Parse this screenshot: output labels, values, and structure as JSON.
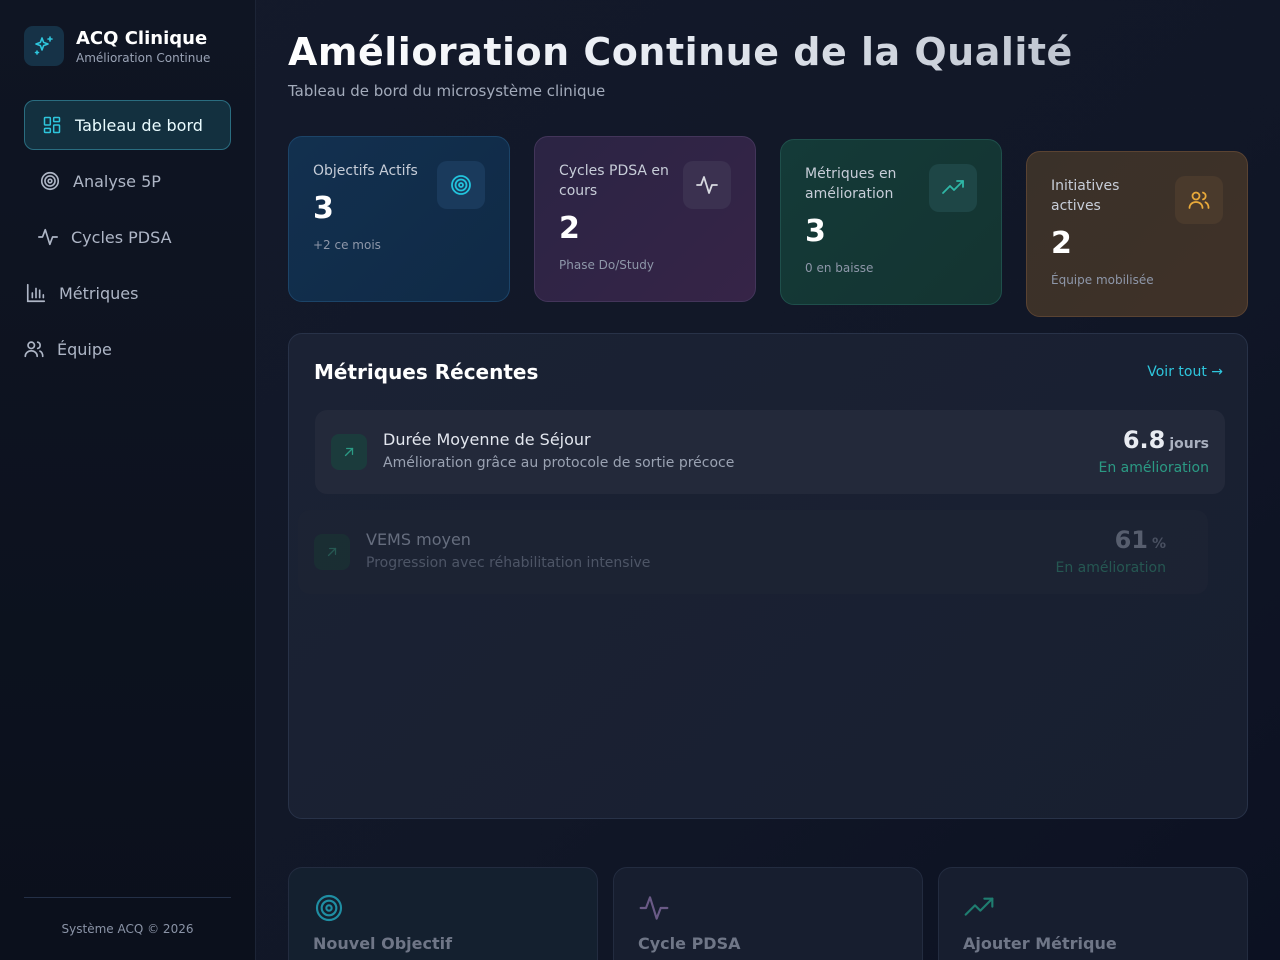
{
  "brand": {
    "title": "ACQ Clinique",
    "subtitle": "Amélioration Continue"
  },
  "nav": {
    "items": [
      {
        "label": "Tableau de bord",
        "icon": "dashboard-icon",
        "active": true
      },
      {
        "label": "Analyse 5P",
        "icon": "target-icon",
        "active": false
      },
      {
        "label": "Cycles PDSA",
        "icon": "activity-icon",
        "active": false
      },
      {
        "label": "Métriques",
        "icon": "bar-chart-icon",
        "active": false
      },
      {
        "label": "Équipe",
        "icon": "users-icon",
        "active": false
      }
    ]
  },
  "footer": "Système ACQ © 2026",
  "header": {
    "title": "Amélioration Continue de la Qualité",
    "subtitle": "Tableau de bord du microsystème clinique"
  },
  "stats": [
    {
      "label": "Objectifs Actifs",
      "value": "3",
      "note": "+2 ce mois",
      "icon": "target-icon",
      "color": "#22c4dd"
    },
    {
      "label": "Cycles PDSA en cours",
      "value": "2",
      "note": "Phase Do/Study",
      "icon": "activity-icon",
      "color": "#d7d9e0"
    },
    {
      "label": "Métriques en amélioration",
      "value": "3",
      "note": "0 en baisse",
      "icon": "trending-up-icon",
      "color": "#2fb7a6"
    },
    {
      "label": "Initiatives actives",
      "value": "2",
      "note": "Équipe mobilisée",
      "icon": "users-icon",
      "color": "#e8a93a"
    }
  ],
  "recent": {
    "title": "Métriques Récentes",
    "link": "Voir tout →",
    "metrics": [
      {
        "name": "Durée Moyenne de Séjour",
        "description": "Amélioration grâce au protocole de sortie précoce",
        "value": "6.8",
        "unit": "jours",
        "status": "En amélioration",
        "icon": "arrow-up-right-icon"
      },
      {
        "name": "VEMS moyen",
        "description": "Progression avec réhabilitation intensive",
        "value": "61",
        "unit": "%",
        "status": "En amélioration",
        "icon": "arrow-up-right-icon"
      }
    ]
  },
  "quick_actions": [
    {
      "label": "Nouvel Objectif",
      "icon": "target-icon"
    },
    {
      "label": "Cycle PDSA",
      "icon": "activity-icon"
    },
    {
      "label": "Ajouter Métrique",
      "icon": "trending-up-icon"
    }
  ],
  "colors": {
    "accent": "#22c4dd",
    "success": "#2b9a84",
    "warning": "#e8a93a"
  }
}
